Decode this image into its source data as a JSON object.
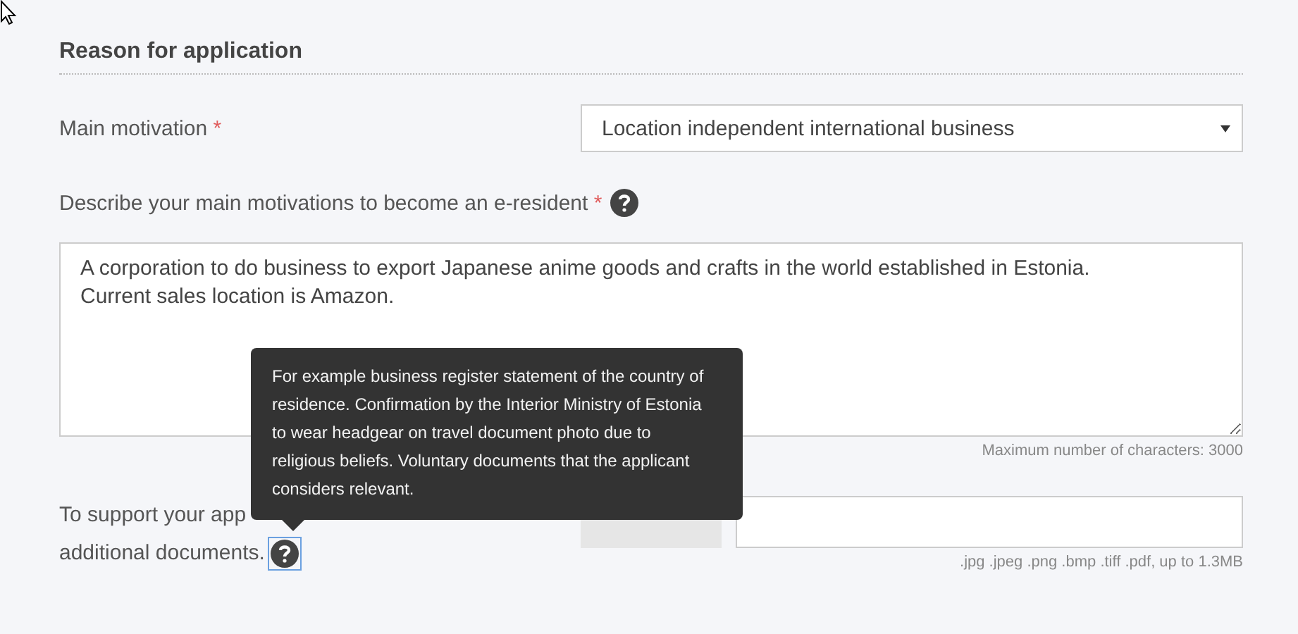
{
  "section": {
    "title": "Reason for application"
  },
  "main_motivation": {
    "label": "Main motivation",
    "required_mark": "*",
    "value": "Location independent international business"
  },
  "description": {
    "label": "Describe your main motivations to become an e-resident",
    "required_mark": "*",
    "value": "A corporation to do business to export Japanese anime goods and crafts in the world established in Estonia.\nCurrent sales location is Amazon.",
    "hint": "Maximum number of characters: 3000"
  },
  "upload": {
    "label_lines": [
      "To support your app",
      "additional documents."
    ],
    "hint": ".jpg .jpeg .png .bmp .tiff .pdf, up to 1.3MB"
  },
  "tooltip": {
    "text": "For example business register statement of the country of residence. Confirmation by the Interior Ministry of Estonia to wear headgear on travel document photo due to religious beliefs. Voluntary documents that the applicant considers relevant."
  }
}
